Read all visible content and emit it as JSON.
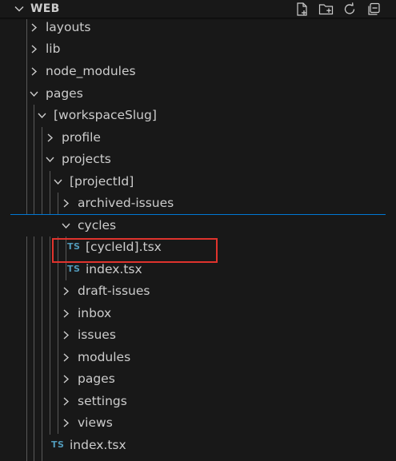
{
  "header": {
    "title": "WEB",
    "icons": [
      "new-file-icon",
      "new-folder-icon",
      "refresh-icon",
      "collapse-all-icon"
    ]
  },
  "tree": {
    "layouts": "layouts",
    "lib": "lib",
    "node_modules": "node_modules",
    "pages": "pages",
    "workspaceSlug": "[workspaceSlug]",
    "profile": "profile",
    "projects": "projects",
    "projectId": "[projectId]",
    "archived_issues": "archived-issues",
    "cycles": "cycles",
    "cycleId_file": "[cycleId].tsx",
    "cycles_index": "index.tsx",
    "draft_issues": "draft-issues",
    "inbox": "inbox",
    "issues": "issues",
    "modules": "modules",
    "pages_sub": "pages",
    "settings": "settings",
    "views": "views",
    "workspace_index": "index.tsx"
  },
  "file_badge": "TS",
  "colors": {
    "background": "#181818",
    "text": "#cccccc",
    "ts_badge": "#519aba",
    "selection_border": "#0078d4",
    "highlight_border": "#e0332d"
  }
}
